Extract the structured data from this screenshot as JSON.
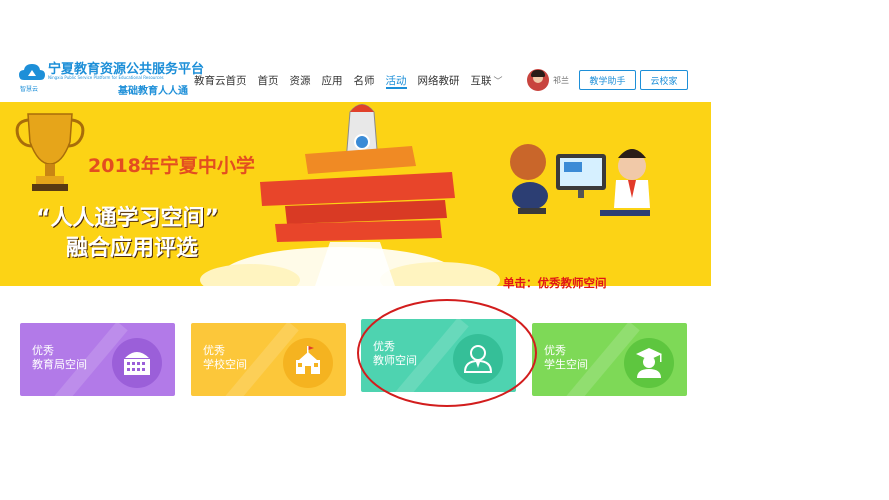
{
  "header": {
    "logo_title": "宁夏教育资源公共服务平台",
    "logo_subtitle": "Ningxia Public Service Platform for Educational Resources",
    "logo_tagline": "基础教育人人通",
    "logo_small": "智慧云"
  },
  "nav": {
    "items": [
      {
        "label": "教育云首页",
        "active": false
      },
      {
        "label": "首页",
        "active": false
      },
      {
        "label": "资源",
        "active": false
      },
      {
        "label": "应用",
        "active": false
      },
      {
        "label": "名师",
        "active": false
      },
      {
        "label": "活动",
        "active": true
      },
      {
        "label": "网络教研",
        "active": false
      },
      {
        "label": "互联",
        "active": false
      }
    ]
  },
  "user": {
    "name": "祁兰",
    "assistant_button": "教学助手",
    "campus_button": "云校家"
  },
  "banner": {
    "line1": "2018年宁夏中小学",
    "line2": "“人人通学习空间”",
    "line3": "融合应用评选"
  },
  "annotation": "单击：优秀教师空间",
  "cards": [
    {
      "line1": "优秀",
      "line2": "教育局空间",
      "icon": "building-icon",
      "color": "#b27ae8"
    },
    {
      "line1": "优秀",
      "line2": "学校空间",
      "icon": "school-icon",
      "color": "#fcc73a"
    },
    {
      "line1": "优秀",
      "line2": "教师空间",
      "icon": "teacher-icon",
      "color": "#4ed3b0"
    },
    {
      "line1": "优秀",
      "line2": "学生空间",
      "icon": "graduate-icon",
      "color": "#7ed957"
    }
  ],
  "colors": {
    "accent": "#1d8fd8",
    "banner_bg": "#fcd315",
    "annotation": "#e01515"
  }
}
